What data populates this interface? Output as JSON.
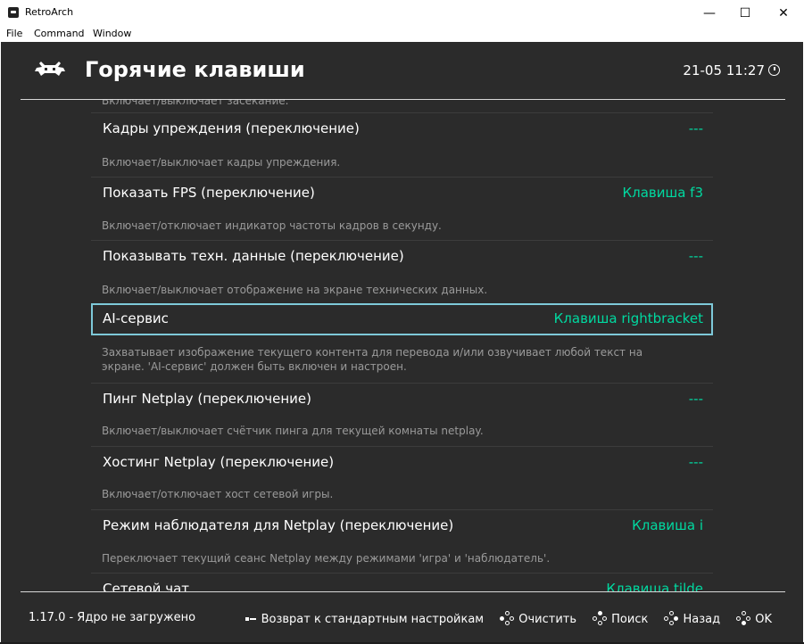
{
  "window": {
    "title": "RetroArch",
    "minimize": "—",
    "maximize": "☐",
    "close": "✕"
  },
  "menu": [
    "File",
    "Command",
    "Window"
  ],
  "header": {
    "title": "Горячие клавиши",
    "clock": "21-05 11:27"
  },
  "list": {
    "clipped_desc": "Включает/выключает засекание.",
    "items": [
      {
        "label": "Кадры упреждения (переключение)",
        "value": "---",
        "desc": "Включает/выключает кадры упреждения.",
        "selected": false
      },
      {
        "label": "Показать FPS (переключение)",
        "value": "Клавиша f3",
        "desc": "Включает/отключает индикатор частоты кадров в секунду.",
        "selected": false
      },
      {
        "label": "Показывать техн. данные (переключение)",
        "value": "---",
        "desc": "Включает/выключает отображение на экране технических данных.",
        "selected": false
      },
      {
        "label": "AI-сервис",
        "value": "Клавиша rightbracket",
        "desc": "Захватывает изображение текущего контента для перевода и/или озвучивает любой текст на экране. 'AI-сервис' должен быть включен и настроен.",
        "selected": true
      },
      {
        "label": "Пинг Netplay (переключение)",
        "value": "---",
        "desc": "Включает/выключает счётчик пинга для текущей комнаты netplay.",
        "selected": false
      },
      {
        "label": "Хостинг Netplay (переключение)",
        "value": "---",
        "desc": "Включает/отключает хост сетевой игры.",
        "selected": false
      },
      {
        "label": "Режим наблюдателя для Netplay (переключение)",
        "value": "Клавиша i",
        "desc": "Переключает текущий сеанс Netplay между режимами 'игра' и 'наблюдатель'.",
        "selected": false
      },
      {
        "label": "Сетевой чат",
        "value": "Клавиша tilde",
        "desc": "",
        "selected": false
      }
    ]
  },
  "footer": {
    "version": "1.17.0 - Ядро не загружено",
    "reset": "Возврат к стандартным настройкам",
    "clear": "Очистить",
    "search": "Поиск",
    "back": "Назад",
    "ok": "OK"
  },
  "colors": {
    "background": "#2b2b2b",
    "value_accent": "#00d9a0",
    "selection_border": "#7ec9d9"
  }
}
